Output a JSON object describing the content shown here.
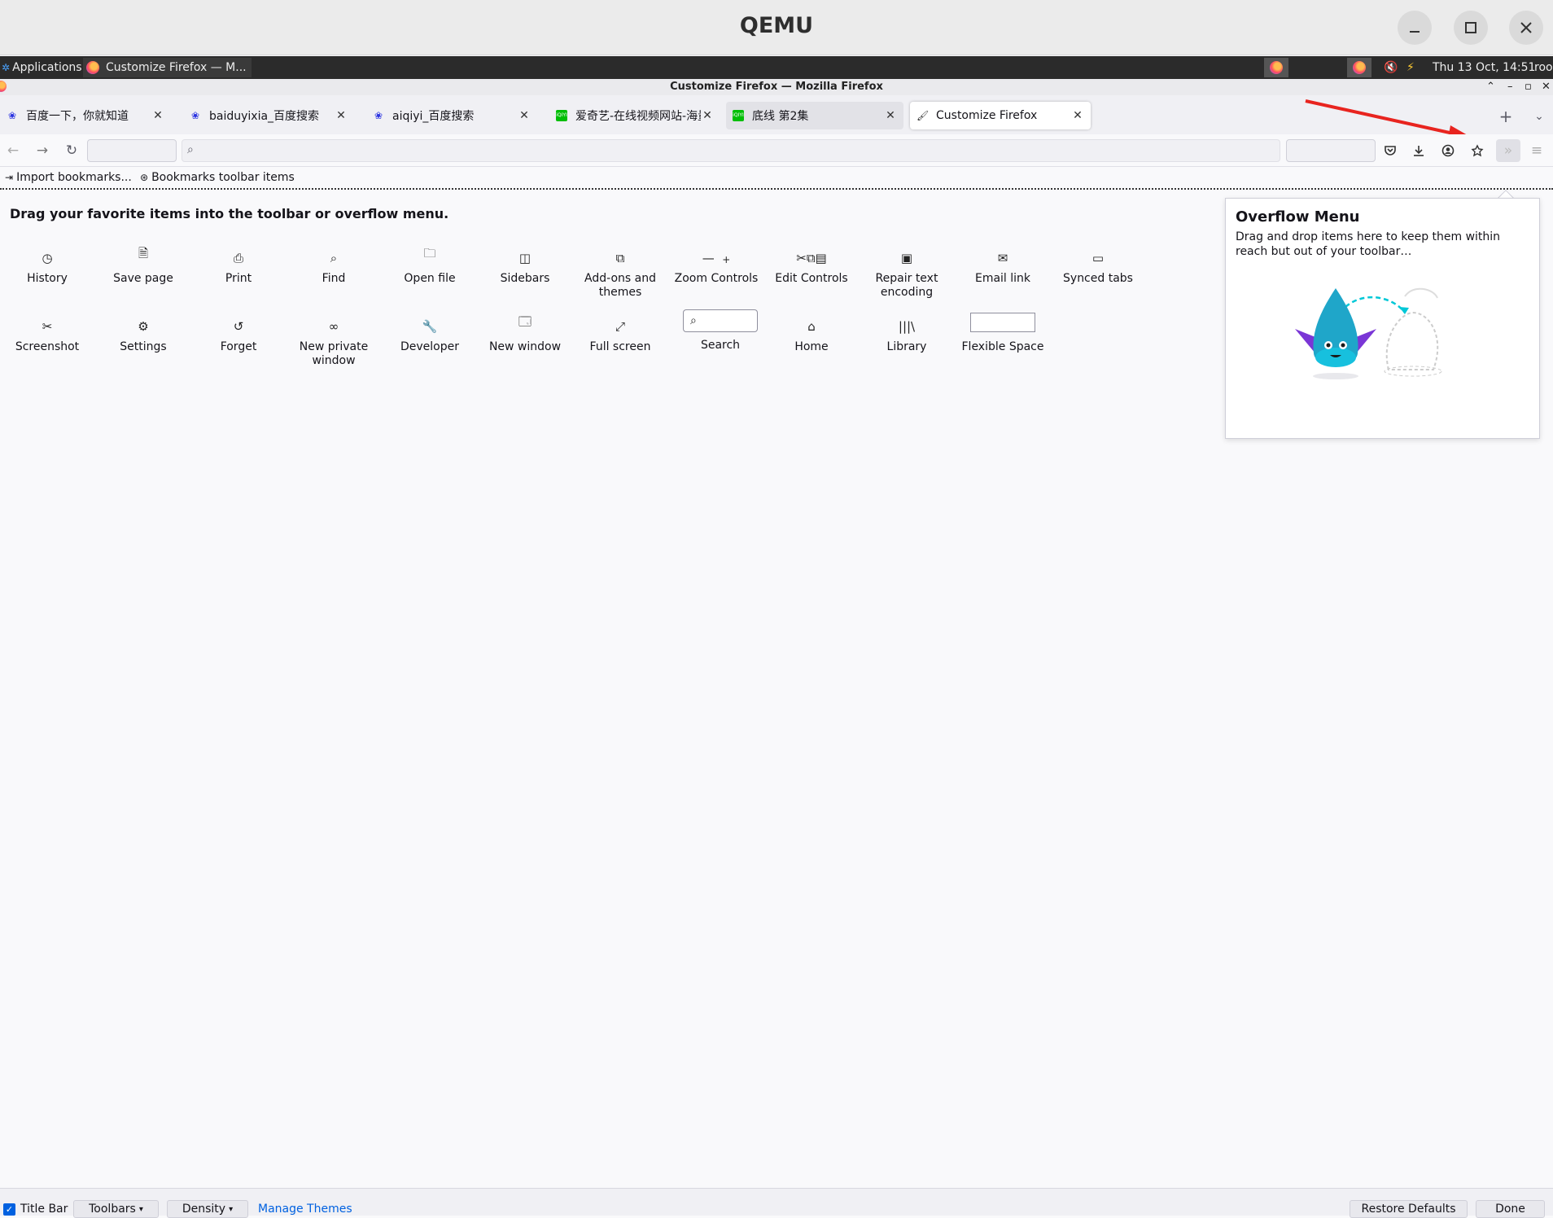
{
  "qemu": {
    "title": "QEMU",
    "minimize_icon": "minimize-icon",
    "maximize_icon": "maximize-icon",
    "close_icon": "close-icon"
  },
  "panel": {
    "applications": "Applications",
    "task_label": "Customize Firefox — M...",
    "clock": "Thu 13 Oct, 14:51",
    "user": "root"
  },
  "firefox": {
    "window_title": "Customize Firefox — Mozilla Firefox"
  },
  "tabs": [
    {
      "label": "百度一下，你就知道",
      "favicon": "baidu-paw-icon"
    },
    {
      "label": "baiduyixia_百度搜索",
      "favicon": "baidu-paw-icon"
    },
    {
      "label": "aiqiyi_百度搜索",
      "favicon": "baidu-paw-icon"
    },
    {
      "label": "爱奇艺-在线视频网站-海量正",
      "favicon": "iqiyi-icon"
    },
    {
      "label": "底线 第2集",
      "favicon": "iqiyi-icon"
    },
    {
      "label": "Customize Firefox",
      "favicon": "customize-icon",
      "selected": true
    }
  ],
  "bookmarks": {
    "import": "Import bookmarks...",
    "toolbar_items": "Bookmarks toolbar items"
  },
  "customize": {
    "instructions": "Drag your favorite items into the toolbar or overflow menu.",
    "row1": [
      {
        "label": "History",
        "icon": "history-icon"
      },
      {
        "label": "Save page",
        "icon": "save-page-icon"
      },
      {
        "label": "Print",
        "icon": "print-icon"
      },
      {
        "label": "Find",
        "icon": "find-icon"
      },
      {
        "label": "Open file",
        "icon": "open-file-icon"
      },
      {
        "label": "Sidebars",
        "icon": "sidebars-icon"
      },
      {
        "label": "Add-ons and themes",
        "icon": "addons-icon"
      },
      {
        "label": "Zoom Controls",
        "icon": "zoom-icon"
      },
      {
        "label": "Edit Controls",
        "icon": "edit-controls-icon"
      },
      {
        "label": "Repair text encoding",
        "icon": "text-encoding-icon"
      },
      {
        "label": "Email link",
        "icon": "email-icon"
      },
      {
        "label": "Synced tabs",
        "icon": "synced-tabs-icon"
      }
    ],
    "row2": [
      {
        "label": "Screenshot",
        "icon": "screenshot-icon"
      },
      {
        "label": "Settings",
        "icon": "settings-icon"
      },
      {
        "label": "Forget",
        "icon": "forget-icon"
      },
      {
        "label": "New private window",
        "icon": "private-window-icon"
      },
      {
        "label": "Developer",
        "icon": "developer-icon"
      },
      {
        "label": "New window",
        "icon": "new-window-icon"
      },
      {
        "label": "Full screen",
        "icon": "full-screen-icon"
      },
      {
        "label": "Search",
        "icon": "search-icon"
      },
      {
        "label": "Home",
        "icon": "home-icon"
      },
      {
        "label": "Library",
        "icon": "library-icon"
      },
      {
        "label": "Flexible Space",
        "icon": "flexible-space-icon"
      }
    ]
  },
  "overflow": {
    "title": "Overflow Menu",
    "description": "Drag and drop items here to keep them within reach but out of your toolbar…"
  },
  "footer": {
    "title_bar": "Title Bar",
    "toolbars": "Toolbars",
    "density": "Density",
    "manage_themes": "Manage Themes",
    "restore_defaults": "Restore Defaults",
    "done": "Done"
  },
  "colors": {
    "accent": "#0061e0",
    "annotation_arrow": "#e8241f"
  }
}
